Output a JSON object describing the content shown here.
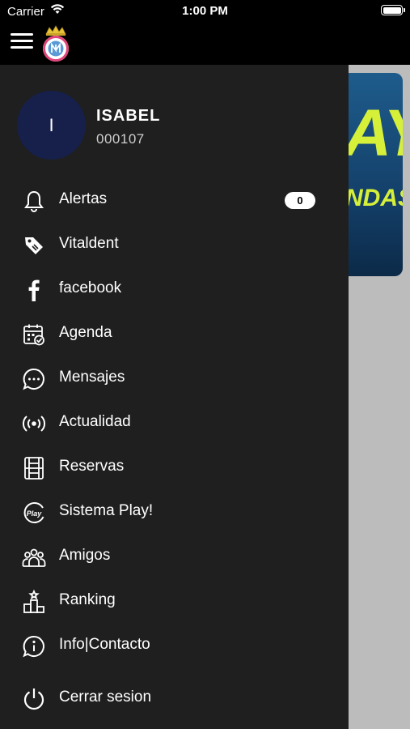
{
  "status_bar": {
    "carrier": "Carrier",
    "time": "1:00 PM"
  },
  "profile": {
    "initial": "I",
    "name": "ISABEL",
    "id": "000107"
  },
  "menu": [
    {
      "label": "Alertas",
      "icon": "bell-icon",
      "badge": "0"
    },
    {
      "label": "Vitaldent",
      "icon": "tag-icon"
    },
    {
      "label": "facebook",
      "icon": "facebook-icon"
    },
    {
      "label": "Agenda",
      "icon": "calendar-check-icon"
    },
    {
      "label": "Mensajes",
      "icon": "chat-bubble-icon"
    },
    {
      "label": "Actualidad",
      "icon": "broadcast-icon"
    },
    {
      "label": "Reservas",
      "icon": "court-icon"
    },
    {
      "label": "Sistema Play!",
      "icon": "play-badge-icon"
    },
    {
      "label": "Amigos",
      "icon": "people-group-icon"
    },
    {
      "label": "Ranking",
      "icon": "podium-icon"
    },
    {
      "label": "Info|Contacto",
      "icon": "info-bubble-icon"
    },
    {
      "label": "Cerrar sesion",
      "icon": "power-icon"
    }
  ],
  "banner": {
    "big_text": "AY",
    "small_text": "NDAS"
  },
  "colors": {
    "drawer": "#1f1f1f",
    "avatar": "#16204a",
    "banner_text": "#d6f03a",
    "backdrop": "#bcbcbc"
  }
}
